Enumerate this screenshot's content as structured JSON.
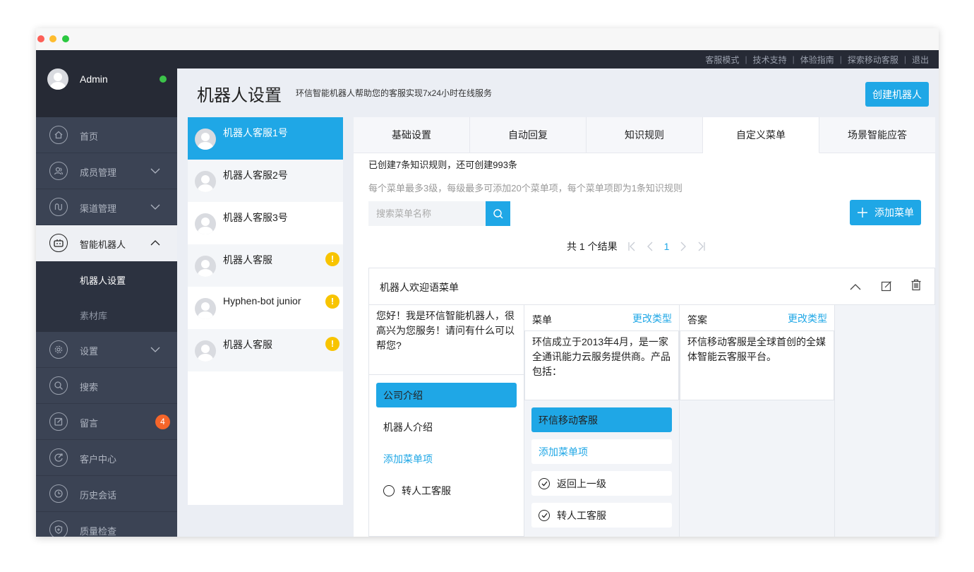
{
  "top_links": [
    "客服模式",
    "技术支持",
    "体验指南",
    "探索移动客服",
    "退出"
  ],
  "user": {
    "name": "Admin",
    "status_color": "#3cc34a"
  },
  "sidebar": {
    "items": [
      {
        "label": "首页",
        "icon": "home-icon"
      },
      {
        "label": "成员管理",
        "icon": "users-icon",
        "chevron": "down"
      },
      {
        "label": "渠道管理",
        "icon": "channel-icon",
        "chevron": "down"
      },
      {
        "label": "智能机器人",
        "icon": "robot-icon",
        "chevron": "up",
        "active": true
      },
      {
        "label": "设置",
        "icon": "gear-icon",
        "chevron": "down"
      },
      {
        "label": "搜索",
        "icon": "search-icon"
      },
      {
        "label": "留言",
        "icon": "edit-icon",
        "badge": "4"
      },
      {
        "label": "客户中心",
        "icon": "customer-icon"
      },
      {
        "label": "历史会话",
        "icon": "clock-icon"
      },
      {
        "label": "质量检查",
        "icon": "shield-icon"
      }
    ],
    "sub_items": [
      "机器人设置",
      "素材库"
    ]
  },
  "header": {
    "title": "机器人设置",
    "subtitle": "环信智能机器人帮助您的客服实现7x24小时在线服务",
    "create_button": "创建机器人"
  },
  "bots": [
    {
      "name": "机器人客服1号",
      "selected": true,
      "warning": false
    },
    {
      "name": "机器人客服2号",
      "selected": false,
      "warning": false
    },
    {
      "name": "机器人客服3号",
      "selected": false,
      "warning": false
    },
    {
      "name": "机器人客服",
      "selected": false,
      "warning": true
    },
    {
      "name": "Hyphen-bot junior",
      "selected": false,
      "warning": true
    },
    {
      "name": "机器人客服",
      "selected": false,
      "warning": true
    }
  ],
  "warning_mark": "!",
  "tabs": [
    {
      "label": "基础设置",
      "active": false
    },
    {
      "label": "自动回复",
      "active": false
    },
    {
      "label": "知识规则",
      "active": false
    },
    {
      "label": "自定义菜单",
      "active": true
    },
    {
      "label": "场景智能应答",
      "active": false
    }
  ],
  "info": {
    "created": "已创建7条知识规则，还可创建993条",
    "hint": "每个菜单最多3级，每级最多可添加20个菜单项，每个菜单项即为1条知识规则"
  },
  "search": {
    "placeholder": "搜索菜单名称"
  },
  "add_menu_button": "添加菜单",
  "pager": {
    "summary": "共 1 个结果",
    "current": "1"
  },
  "menu_card": {
    "title": "机器人欢迎语菜单",
    "welcome_text": "您好！我是环信智能机器人，很高兴为您服务！请问有什么可以帮您?",
    "col1_items": [
      "公司介绍",
      "机器人介绍"
    ],
    "col1_add": "添加菜单项",
    "col1_transfer": "转人工客服",
    "col2_header": "菜单",
    "col2_change": "更改类型",
    "col2_text": "环信成立于2013年4月，是一家全通讯能力云服务提供商。产品包括：",
    "col2_items": [
      "环信移动客服"
    ],
    "col2_add": "添加菜单项",
    "col2_back": "返回上一级",
    "col2_transfer": "转人工客服",
    "col3_header": "答案",
    "col3_change": "更改类型",
    "col3_text": "环信移动客服是全球首创的全媒体智能云客服平台。"
  },
  "colors": {
    "accent": "#1fa7e6",
    "sidebar": "#3b4354",
    "topbar": "#262a35",
    "badge": "#f5652a",
    "warning": "#f8c400"
  }
}
